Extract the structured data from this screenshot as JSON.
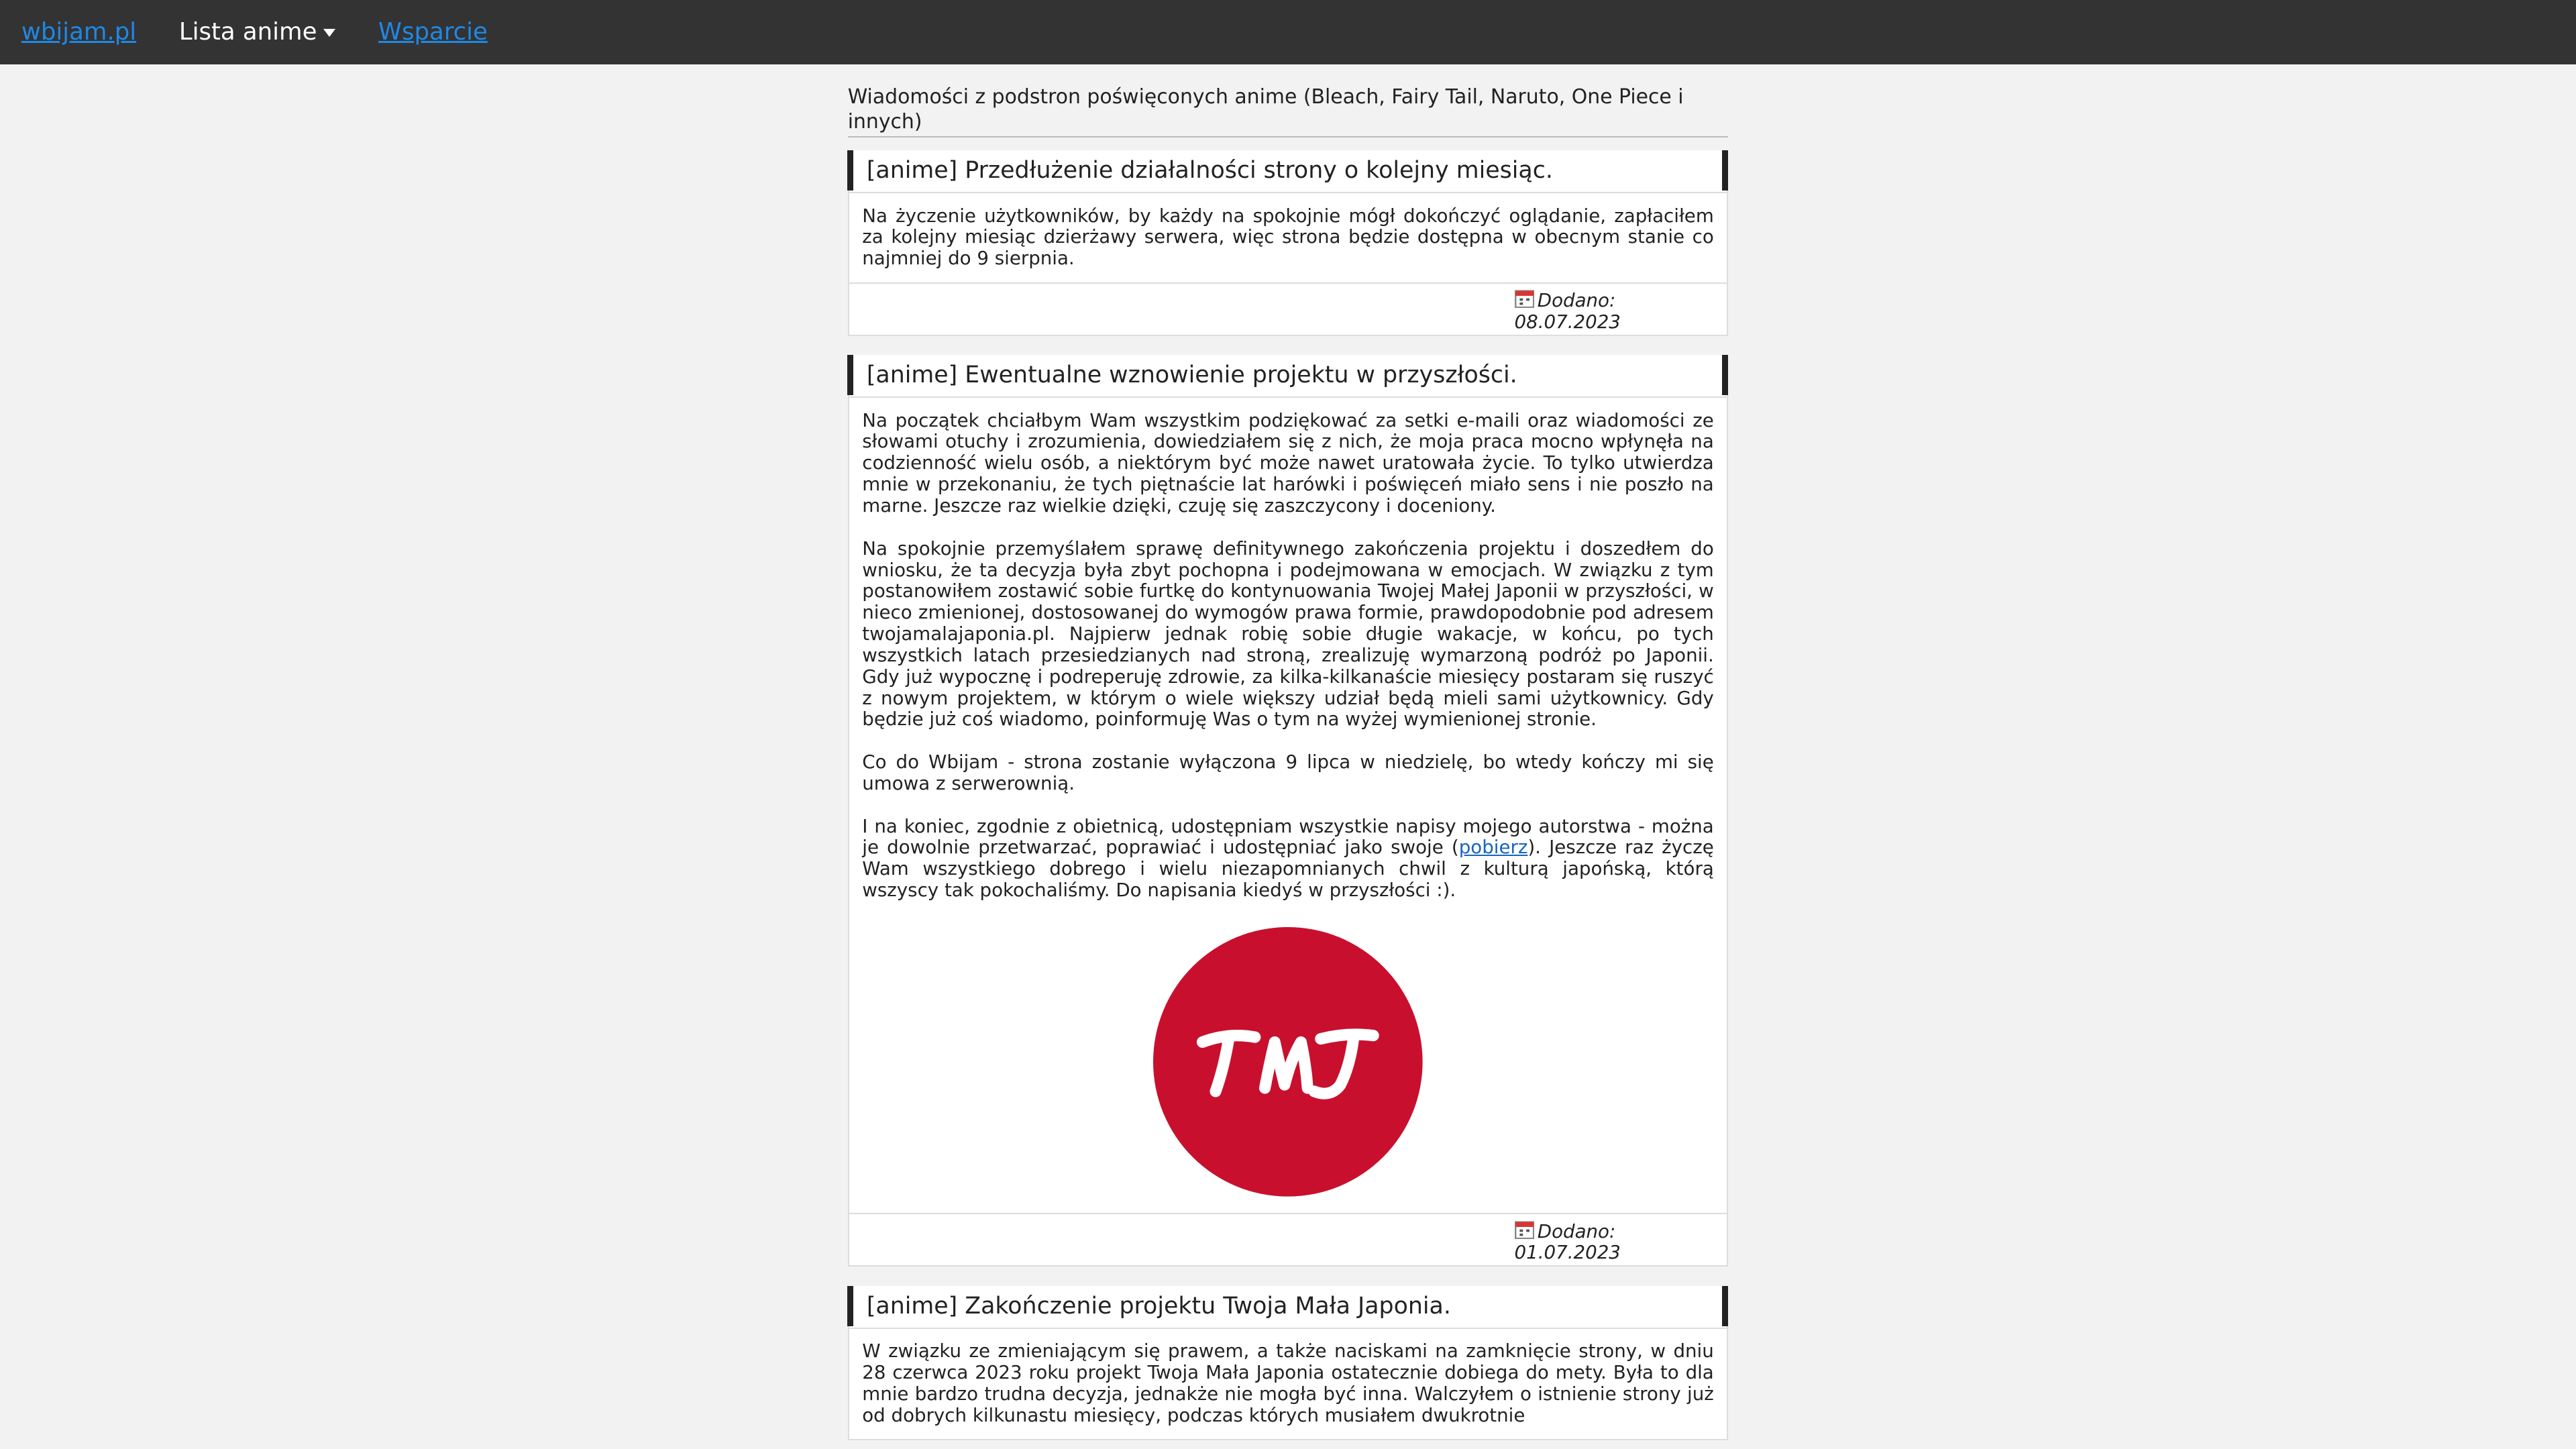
{
  "nav": {
    "brand": "wbijam.pl",
    "dropdown_label": "Lista anime",
    "support": "Wsparcie"
  },
  "intro": "Wiadomości z podstron poświęconych anime (Bleach, Fairy Tail, Naruto, One Piece i innych)",
  "posts": [
    {
      "title": "[anime] Przedłużenie działalności strony o kolejny miesiąc.",
      "paragraphs": [
        "Na życzenie użytkowników, by każdy na spokojnie mógł dokończyć oglądanie, zapłaciłem za kolejny miesiąc dzierżawy serwera, więc strona będzie dostępna w obecnym stanie co najmniej do 9 sierpnia."
      ],
      "date_label": "Dodano:",
      "date": "08.07.2023"
    },
    {
      "title": "[anime] Ewentualne wznowienie projektu w przyszłości.",
      "paragraphs": [
        "Na początek chciałbym Wam wszystkim podziękować za setki e-maili oraz wiadomości ze słowami otuchy i zrozumienia, dowiedziałem się z nich, że moja praca mocno wpłynęła na codzienność wielu osób, a niektórym być może nawet uratowała życie. To tylko utwierdza mnie w przekonaniu, że tych piętnaście lat harówki i poświęceń miało sens i nie poszło na marne. Jeszcze raz wielkie dzięki, czuję się zaszczycony i doceniony.",
        "Na spokojnie przemyślałem sprawę definitywnego zakończenia projektu i doszedłem do wniosku, że ta decyzja była zbyt pochopna i podejmowana w emocjach. W związku z tym postanowiłem zostawić sobie furtkę do kontynuowania Twojej Małej Japonii w przyszłości, w nieco zmienionej, dostosowanej do wymogów prawa formie, prawdopodobnie pod adresem twojamalajaponia.pl. Najpierw jednak robię sobie długie wakacje, w końcu, po tych wszystkich latach przesiedzianych nad stroną, zrealizuję wymarzoną podróż po Japonii. Gdy już wypocznę i podreperuję zdrowie, za kilka-kilkanaście miesięcy postaram się ruszyć z nowym projektem, w którym o wiele większy udział będą mieli sami użytkownicy. Gdy będzie już coś wiadomo, poinformuję Was o tym na wyżej wymienionej stronie.",
        "Co do Wbijam - strona zostanie wyłączona 9 lipca w niedzielę, bo wtedy kończy mi się umowa z serwerownią."
      ],
      "last_para_before": "I na koniec, zgodnie z obietnicą, udostępniam wszystkie napisy mojego autorstwa - można je dowolnie przetwarzać, poprawiać i udostępniać jako swoje (",
      "last_para_link": "pobierz",
      "last_para_after": "). Jeszcze raz życzę Wam wszystkiego dobrego i wielu niezapomnianych chwil z kulturą japońską, którą wszyscy tak pokochaliśmy. Do napisania kiedyś w przyszłości :).",
      "logo_text": "TMJ",
      "logo_color": "#c8102e",
      "date_label": "Dodano:",
      "date": "01.07.2023"
    },
    {
      "title": "[anime] Zakończenie projektu Twoja Mała Japonia.",
      "paragraphs": [
        "W związku ze zmieniającym się prawem, a także naciskami na zamknięcie strony, w dniu 28 czerwca 2023 roku projekt Twoja Mała Japonia ostatecznie dobiega do mety. Była to dla mnie bardzo trudna decyzja, jednakże nie mogła być inna. Walczyłem o istnienie strony już od dobrych kilkunastu miesięcy, podczas których musiałem dwukrotnie"
      ]
    }
  ],
  "colors": {
    "nav_bg": "#333333",
    "link": "#1e88e5",
    "page_bg": "#f2f2f2"
  }
}
